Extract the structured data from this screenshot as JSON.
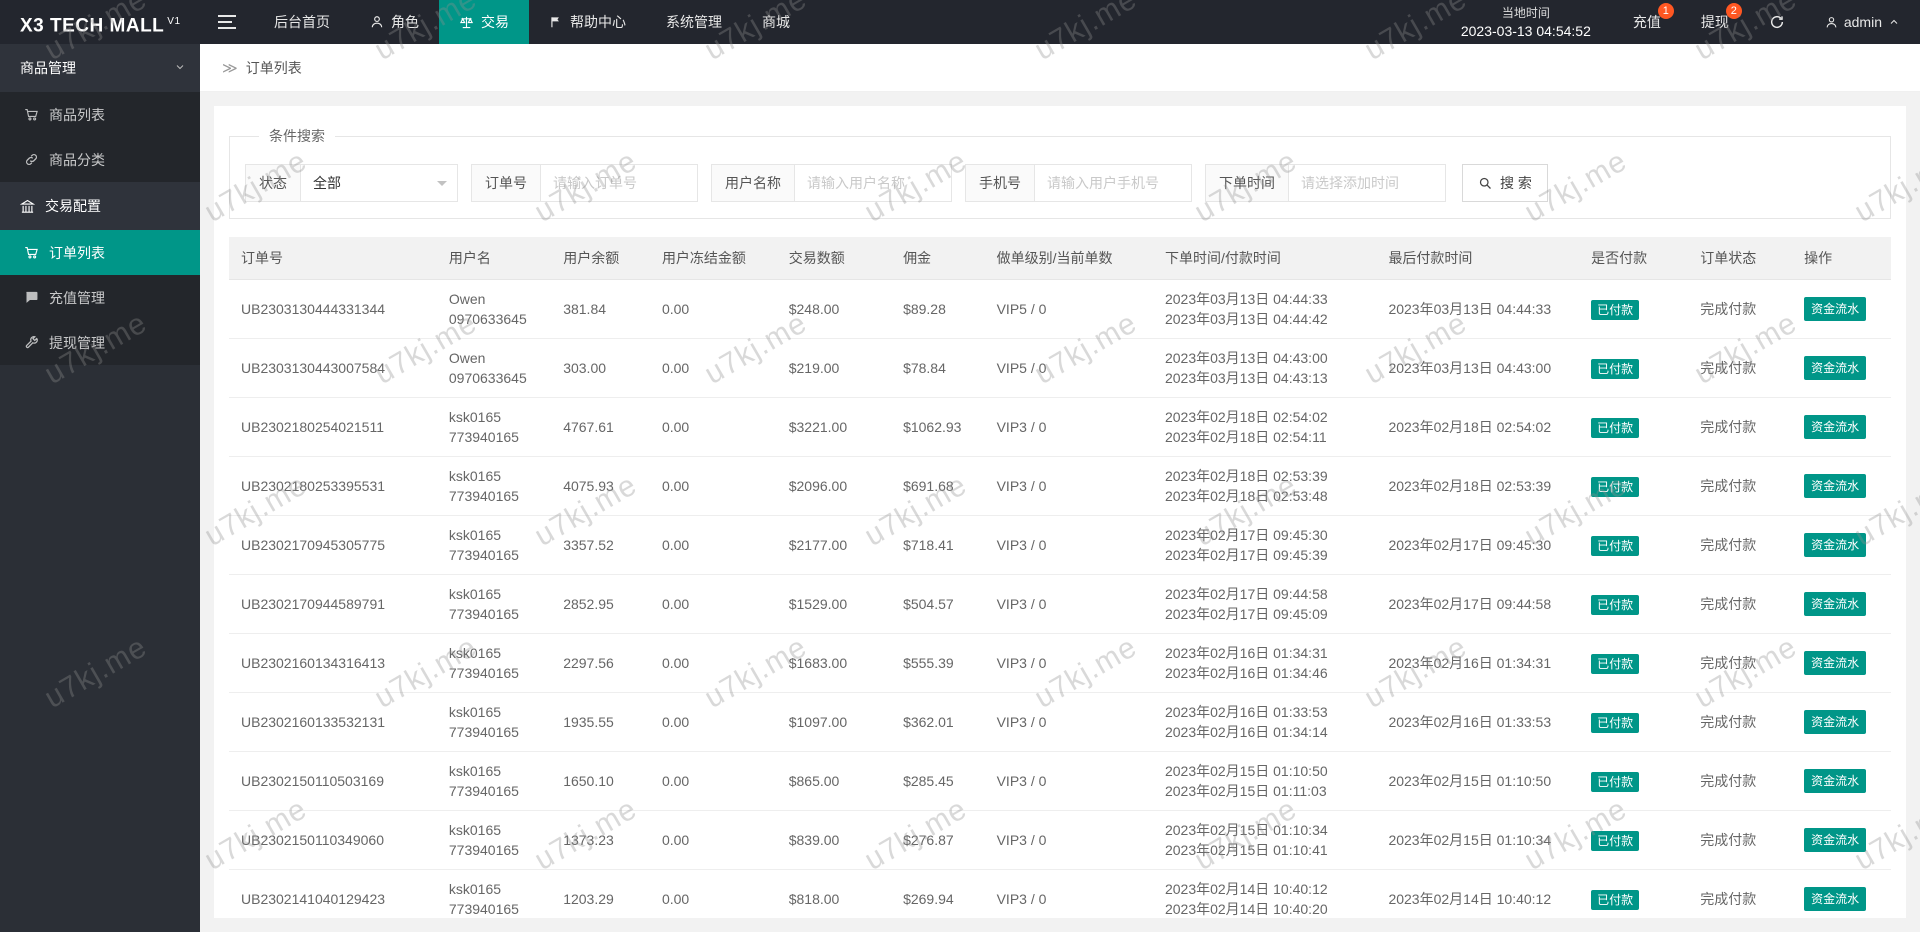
{
  "watermark": {
    "text": "u7kj.me"
  },
  "colors": {
    "accent": "#009688",
    "badge": "#ff5722",
    "topbar_bg": "#23262e",
    "sidebar_bg": "#2b2f36"
  },
  "topbar": {
    "logo": "X3 TECH MALL",
    "logo_version": "V1",
    "nav": [
      {
        "label": "后台首页"
      },
      {
        "label": "角色"
      },
      {
        "label": "交易"
      },
      {
        "label": "帮助中心"
      },
      {
        "label": "系统管理"
      },
      {
        "label": "商城"
      }
    ],
    "local_time_label": "当地时间",
    "local_time_value": "2023-03-13 04:54:52",
    "recharge_label": "充值",
    "recharge_badge": "1",
    "withdraw_label": "提现",
    "withdraw_badge": "2",
    "username": "admin"
  },
  "sidebar": {
    "sections": [
      {
        "label": "商品管理",
        "children": [
          {
            "label": "商品列表"
          },
          {
            "label": "商品分类"
          }
        ]
      },
      {
        "label": "交易配置",
        "children": [
          {
            "label": "订单列表"
          },
          {
            "label": "充值管理"
          },
          {
            "label": "提现管理"
          }
        ]
      }
    ]
  },
  "breadcrumb": {
    "separator": "≫",
    "current": "订单列表"
  },
  "search": {
    "legend": "条件搜索",
    "status_label": "状态",
    "status_value": "全部",
    "order_label": "订单号",
    "order_placeholder": "请输入订单号",
    "user_label": "用户名称",
    "user_placeholder": "请输入用户名称",
    "phone_label": "手机号",
    "phone_placeholder": "请输入用户手机号",
    "time_label": "下单时间",
    "time_placeholder": "请选择添加时间",
    "search_button": "搜 索"
  },
  "table": {
    "columns": [
      "订单号",
      "用户名",
      "用户余额",
      "用户冻结金额",
      "交易数额",
      "佣金",
      "做单级别/当前单数",
      "下单时间/付款时间",
      "最后付款时间",
      "是否付款",
      "订单状态",
      "操作"
    ],
    "rows": [
      {
        "order_no": "UB2303130444331344",
        "user_name": "Owen",
        "user_account": "0970633645",
        "balance": "381.84",
        "frozen": "0.00",
        "trade_amount": "$248.00",
        "commission": "$89.28",
        "vip_level": "VIP5 / 0",
        "order_time": "2023年03月13日 04:44:33",
        "pay_time": "2023年03月13日 04:44:42",
        "last_pay_time": "2023年03月13日 04:44:33",
        "paid_status": "已付款",
        "order_status": "完成付款",
        "action_label": "资金流水"
      },
      {
        "order_no": "UB2303130443007584",
        "user_name": "Owen",
        "user_account": "0970633645",
        "balance": "303.00",
        "frozen": "0.00",
        "trade_amount": "$219.00",
        "commission": "$78.84",
        "vip_level": "VIP5 / 0",
        "order_time": "2023年03月13日 04:43:00",
        "pay_time": "2023年03月13日 04:43:13",
        "last_pay_time": "2023年03月13日 04:43:00",
        "paid_status": "已付款",
        "order_status": "完成付款",
        "action_label": "资金流水"
      },
      {
        "order_no": "UB2302180254021511",
        "user_name": "ksk0165",
        "user_account": "773940165",
        "balance": "4767.61",
        "frozen": "0.00",
        "trade_amount": "$3221.00",
        "commission": "$1062.93",
        "vip_level": "VIP3 / 0",
        "order_time": "2023年02月18日 02:54:02",
        "pay_time": "2023年02月18日 02:54:11",
        "last_pay_time": "2023年02月18日 02:54:02",
        "paid_status": "已付款",
        "order_status": "完成付款",
        "action_label": "资金流水"
      },
      {
        "order_no": "UB2302180253395531",
        "user_name": "ksk0165",
        "user_account": "773940165",
        "balance": "4075.93",
        "frozen": "0.00",
        "trade_amount": "$2096.00",
        "commission": "$691.68",
        "vip_level": "VIP3 / 0",
        "order_time": "2023年02月18日 02:53:39",
        "pay_time": "2023年02月18日 02:53:48",
        "last_pay_time": "2023年02月18日 02:53:39",
        "paid_status": "已付款",
        "order_status": "完成付款",
        "action_label": "资金流水"
      },
      {
        "order_no": "UB2302170945305775",
        "user_name": "ksk0165",
        "user_account": "773940165",
        "balance": "3357.52",
        "frozen": "0.00",
        "trade_amount": "$2177.00",
        "commission": "$718.41",
        "vip_level": "VIP3 / 0",
        "order_time": "2023年02月17日 09:45:30",
        "pay_time": "2023年02月17日 09:45:39",
        "last_pay_time": "2023年02月17日 09:45:30",
        "paid_status": "已付款",
        "order_status": "完成付款",
        "action_label": "资金流水"
      },
      {
        "order_no": "UB2302170944589791",
        "user_name": "ksk0165",
        "user_account": "773940165",
        "balance": "2852.95",
        "frozen": "0.00",
        "trade_amount": "$1529.00",
        "commission": "$504.57",
        "vip_level": "VIP3 / 0",
        "order_time": "2023年02月17日 09:44:58",
        "pay_time": "2023年02月17日 09:45:09",
        "last_pay_time": "2023年02月17日 09:44:58",
        "paid_status": "已付款",
        "order_status": "完成付款",
        "action_label": "资金流水"
      },
      {
        "order_no": "UB2302160134316413",
        "user_name": "ksk0165",
        "user_account": "773940165",
        "balance": "2297.56",
        "frozen": "0.00",
        "trade_amount": "$1683.00",
        "commission": "$555.39",
        "vip_level": "VIP3 / 0",
        "order_time": "2023年02月16日 01:34:31",
        "pay_time": "2023年02月16日 01:34:46",
        "last_pay_time": "2023年02月16日 01:34:31",
        "paid_status": "已付款",
        "order_status": "完成付款",
        "action_label": "资金流水"
      },
      {
        "order_no": "UB2302160133532131",
        "user_name": "ksk0165",
        "user_account": "773940165",
        "balance": "1935.55",
        "frozen": "0.00",
        "trade_amount": "$1097.00",
        "commission": "$362.01",
        "vip_level": "VIP3 / 0",
        "order_time": "2023年02月16日 01:33:53",
        "pay_time": "2023年02月16日 01:34:14",
        "last_pay_time": "2023年02月16日 01:33:53",
        "paid_status": "已付款",
        "order_status": "完成付款",
        "action_label": "资金流水"
      },
      {
        "order_no": "UB2302150110503169",
        "user_name": "ksk0165",
        "user_account": "773940165",
        "balance": "1650.10",
        "frozen": "0.00",
        "trade_amount": "$865.00",
        "commission": "$285.45",
        "vip_level": "VIP3 / 0",
        "order_time": "2023年02月15日 01:10:50",
        "pay_time": "2023年02月15日 01:11:03",
        "last_pay_time": "2023年02月15日 01:10:50",
        "paid_status": "已付款",
        "order_status": "完成付款",
        "action_label": "资金流水"
      },
      {
        "order_no": "UB2302150110349060",
        "user_name": "ksk0165",
        "user_account": "773940165",
        "balance": "1373.23",
        "frozen": "0.00",
        "trade_amount": "$839.00",
        "commission": "$276.87",
        "vip_level": "VIP3 / 0",
        "order_time": "2023年02月15日 01:10:34",
        "pay_time": "2023年02月15日 01:10:41",
        "last_pay_time": "2023年02月15日 01:10:34",
        "paid_status": "已付款",
        "order_status": "完成付款",
        "action_label": "资金流水"
      },
      {
        "order_no": "UB2302141040129423",
        "user_name": "ksk0165",
        "user_account": "773940165",
        "balance": "1203.29",
        "frozen": "0.00",
        "trade_amount": "$818.00",
        "commission": "$269.94",
        "vip_level": "VIP3 / 0",
        "order_time": "2023年02月14日 10:40:12",
        "pay_time": "2023年02月14日 10:40:20",
        "last_pay_time": "2023年02月14日 10:40:12",
        "paid_status": "已付款",
        "order_status": "完成付款",
        "action_label": "资金流水"
      }
    ]
  }
}
